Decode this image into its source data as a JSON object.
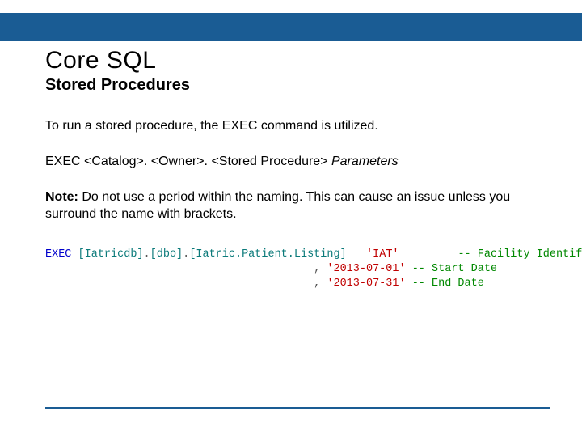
{
  "title": "Core SQL",
  "subtitle": "Stored Procedures",
  "intro": "To run a stored procedure, the EXEC command is utilized.",
  "syntax": {
    "prefix": "EXEC <Catalog>. <Owner>. <Stored Procedure> ",
    "params_italic": "Parameters"
  },
  "note": {
    "label": "Note:",
    "text": " Do not use a period within the naming.  This can cause an issue unless you surround the name with brackets."
  },
  "code": {
    "keyword": "EXEC",
    "catalog": "[Iatricdb]",
    "owner": "[dbo]",
    "proc": "[Iatric.Patient.Listing]",
    "dot": ".",
    "args": [
      {
        "lead": "   ",
        "value": "'IAT'",
        "pad": "         ",
        "comment": "-- Facility Identifier"
      },
      {
        "lead": " , ",
        "value": "'2013-07-01'",
        "pad": " ",
        "comment": "-- Start Date"
      },
      {
        "lead": " , ",
        "value": "'2013-07-31'",
        "pad": " ",
        "comment": "-- End Date"
      }
    ]
  }
}
